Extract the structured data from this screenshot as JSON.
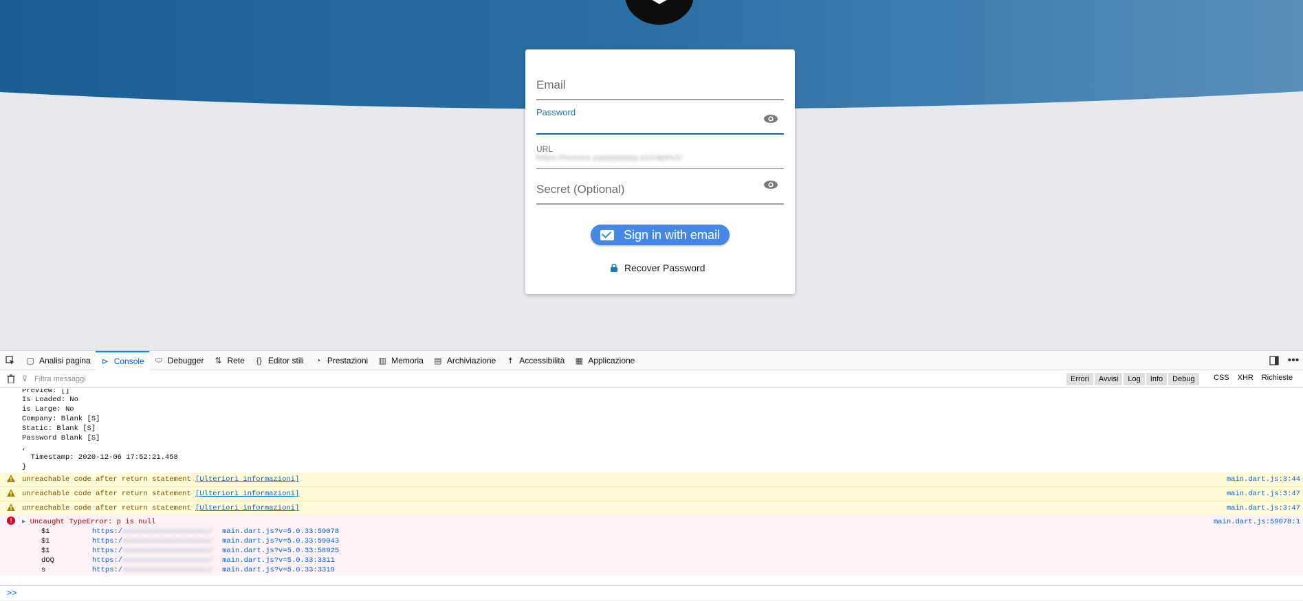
{
  "login": {
    "email_placeholder": "Email",
    "password_label": "Password",
    "url_label": "URL",
    "url_value_blurred": "https://xxxxxx.yyyyyyyyyy.zzz/api/v1/",
    "secret_placeholder": "Secret (Optional)",
    "signin_label": "Sign in with email",
    "recover_label": "Recover Password"
  },
  "colors": {
    "hero_dark": "#1a5e96",
    "hero_light": "#5a8fb9",
    "page_bg": "#e7e9ec",
    "primary_button": "#4588e4",
    "focus": "#1565a0"
  },
  "devtools": {
    "tabs": [
      {
        "label": "Analisi pagina",
        "icon": "inspector-icon"
      },
      {
        "label": "Console",
        "icon": "console-icon"
      },
      {
        "label": "Debugger",
        "icon": "debugger-icon"
      },
      {
        "label": "Rete",
        "icon": "network-icon"
      },
      {
        "label": "Editor stili",
        "icon": "style-editor-icon"
      },
      {
        "label": "Prestazioni",
        "icon": "performance-icon"
      },
      {
        "label": "Memoria",
        "icon": "memory-icon"
      },
      {
        "label": "Archiviazione",
        "icon": "storage-icon"
      },
      {
        "label": "Accessibilità",
        "icon": "accessibility-icon"
      },
      {
        "label": "Applicazione",
        "icon": "application-icon"
      }
    ],
    "filter_placeholder": "Filtra messaggi",
    "levels": [
      "Errori",
      "Avvisi",
      "Log",
      "Info",
      "Debug"
    ],
    "types": [
      "CSS",
      "XHR",
      "Richieste"
    ],
    "log_lines": [
      "Preview: []",
      "Is Loaded: No",
      "is Large: No",
      "Company: Blank [S]",
      "Static: Blank [S]",
      "Password Blank [S]",
      ",",
      "  Timestamp: 2020-12-06 17:52:21.458",
      "}"
    ],
    "warnings": [
      {
        "text": "unreachable code after return statement ",
        "link": "[Ulteriori informazioni]",
        "source": "main.dart.js:3:44"
      },
      {
        "text": "unreachable code after return statement ",
        "link": "[Ulteriori informazioni]",
        "source": "main.dart.js:3:47"
      },
      {
        "text": "unreachable code after return statement ",
        "link": "[Ulteriori informazioni]",
        "source": "main.dart.js:3:47"
      }
    ],
    "error": {
      "text": "Uncaught TypeError: p is null",
      "source": "main.dart.js:59078:1",
      "trace": [
        {
          "fn": "$1",
          "prefix": "https:/",
          "blurred": "xxxxxxxxxxxxxxxxxxxx/",
          "file": "main.dart.js?v=5.0.33:59078"
        },
        {
          "fn": "$1",
          "prefix": "https:/",
          "blurred": "xxxxxxxxxxxxxxxxxxxx/",
          "file": "main.dart.js?v=5.0.33:59043"
        },
        {
          "fn": "$1",
          "prefix": "https:/",
          "blurred": "xxxxxxxxxxxxxxxxxxxx/",
          "file": "main.dart.js?v=5.0.33:58925"
        },
        {
          "fn": "dOQ",
          "prefix": "https:/",
          "blurred": "xxxxxxxxxxxxxxxxxxxx/",
          "file": "main.dart.js?v=5.0.33:3311"
        },
        {
          "fn": "s",
          "prefix": "https:/",
          "blurred": "xxxxxxxxxxxxxxxxxxxx/",
          "file": "main.dart.js?v=5.0.33:3319"
        }
      ]
    },
    "prompt": ">>"
  }
}
